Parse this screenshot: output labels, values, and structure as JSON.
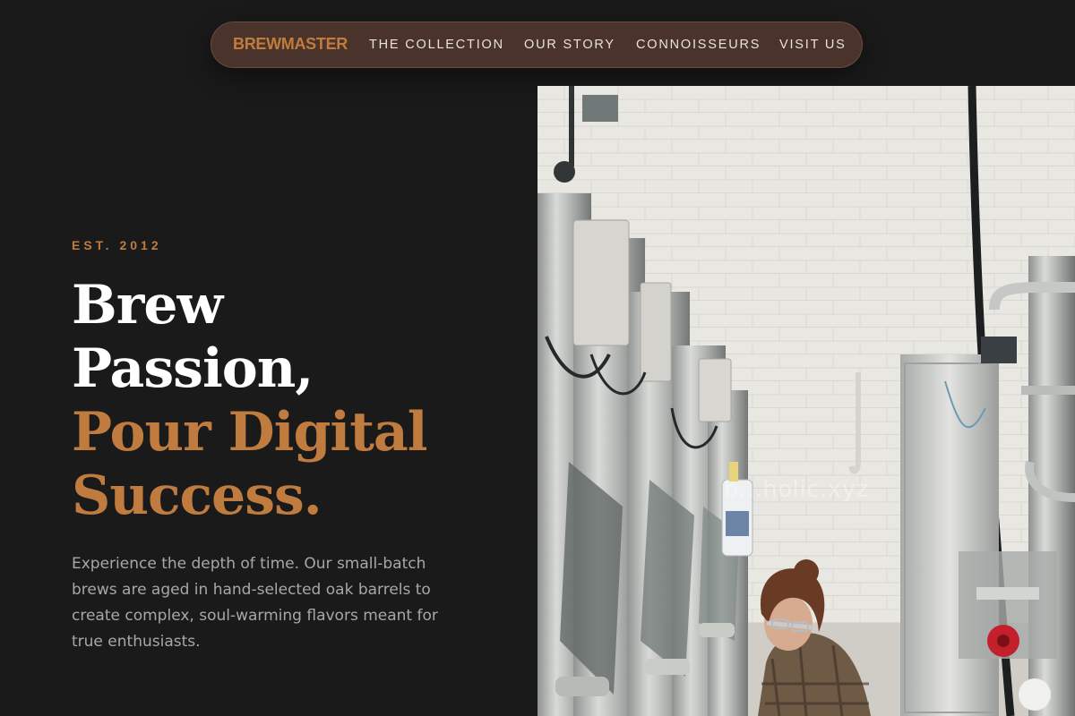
{
  "nav": {
    "brand": "BREWMASTER",
    "links": [
      {
        "label": "THE COLLECTION"
      },
      {
        "label": "OUR STORY"
      },
      {
        "label": "CONNOISSEURS"
      },
      {
        "label": "VISIT US"
      }
    ]
  },
  "hero": {
    "eyebrow": "EST. 2012",
    "headline_lines": [
      "Brew",
      "Passion,",
      "Pour Digital",
      "Success."
    ],
    "description": "Experience the depth of time. Our small-batch brews are aged in hand-selected oak barrels to create complex, soul-warming flavors meant for true enthusiasts.",
    "image": {
      "alt": "Brewer inspecting stainless steel fermentation tanks",
      "watermark": "b...holic.xyz"
    }
  },
  "colors": {
    "background": "#1b1a1a",
    "accent": "#c07c3f",
    "nav_pill": "#4a332b",
    "body_text": "#a9a6a9"
  }
}
